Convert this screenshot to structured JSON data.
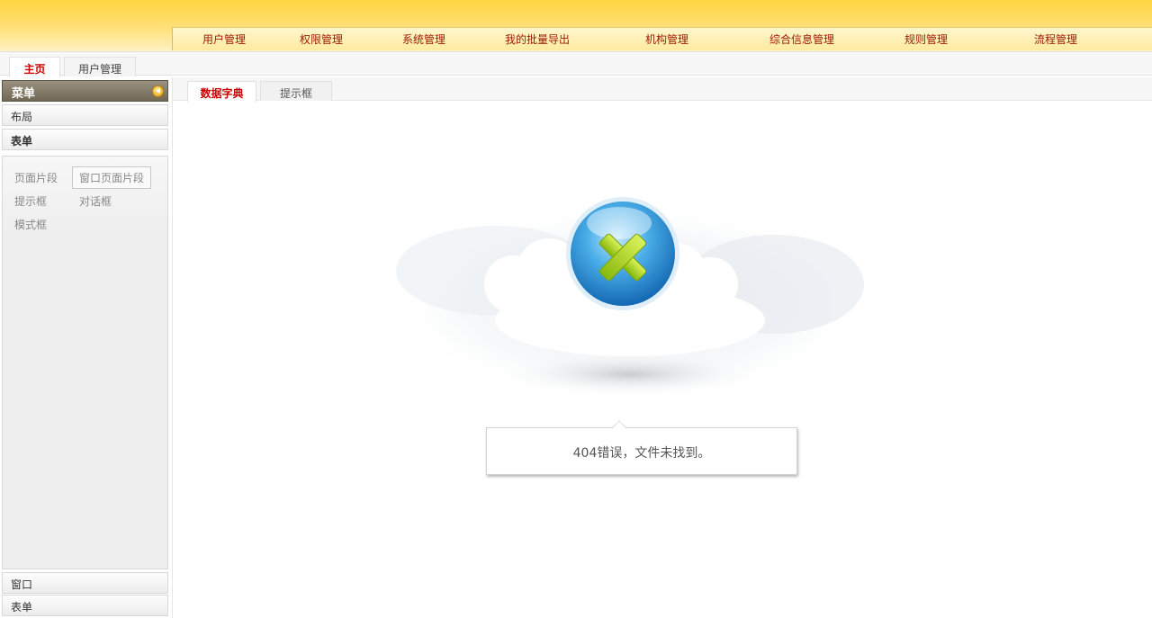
{
  "top_nav": {
    "items": [
      "用户管理",
      "权限管理",
      "系统管理",
      "我的批量导出",
      "机构管理",
      "综合信息管理",
      "规则管理",
      "流程管理"
    ]
  },
  "main_tabs": [
    {
      "label": "主页",
      "active": true
    },
    {
      "label": "用户管理",
      "active": false
    }
  ],
  "sidebar": {
    "title": "菜单",
    "collapse_icon": "collapse-left-icon",
    "sections_top": [
      "布局",
      "表单"
    ],
    "links": [
      "页面片段",
      "窗口页面片段",
      "提示框",
      "对话框",
      "模式框"
    ],
    "sections_bottom": [
      "窗口",
      "表单"
    ]
  },
  "content": {
    "tabs": [
      {
        "label": "数据字典",
        "active": true
      },
      {
        "label": "提示框",
        "active": false
      }
    ],
    "error_icon": "error-x-icon",
    "error_message": "404错误，文件未找到。"
  },
  "colors": {
    "header_yellow": "#ffd440",
    "nav_text": "#9a1a00",
    "active_tab_text": "#cc0000",
    "error_icon_green": "#a6d11a",
    "error_icon_blue": "#3a9ee0"
  }
}
